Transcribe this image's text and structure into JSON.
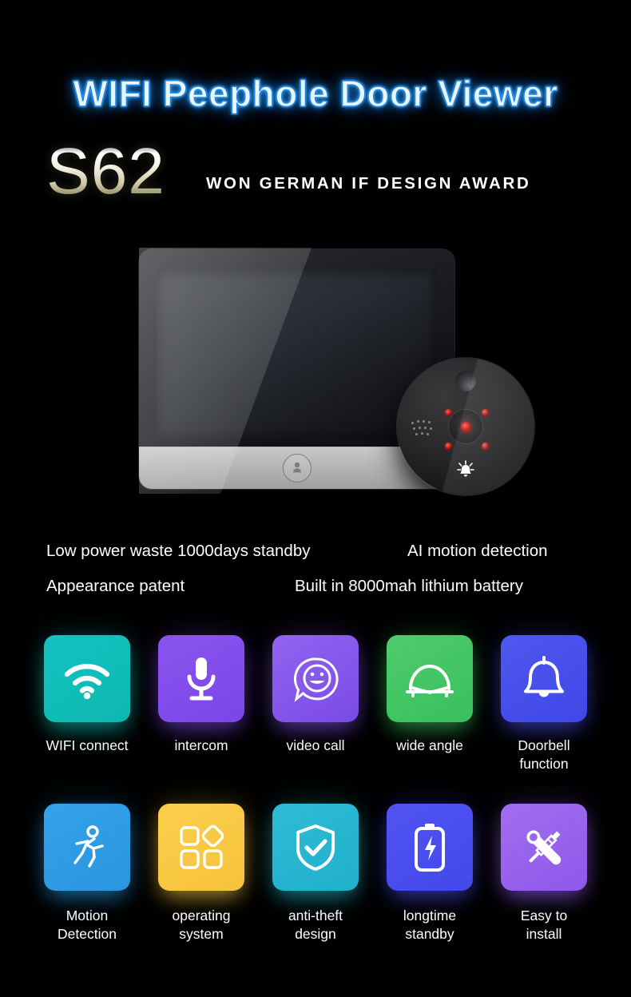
{
  "hero": {
    "title": "WIFI Peephole Door Viewer",
    "model": "S62",
    "award": "WON GERMAN IF DESIGN AWARD",
    "title_color": "#eaf6ff",
    "title_glow_color": "#1f86e0"
  },
  "product": {
    "monitor_name": "indoor-monitor",
    "home_button_icon": "person-icon",
    "camera_name": "outdoor-camera-unit",
    "camera_parts": {
      "pir_sensor": "pir-dome",
      "lens": "camera-lens",
      "ir_leds": 4,
      "microphone": "mic-grille",
      "doorbell_mark": "bell-icon"
    }
  },
  "sentences": [
    "Low power waste 1000days standby",
    "AI motion detection",
    "Appearance patent",
    "Built in 8000mah lithium battery"
  ],
  "features_row1": [
    {
      "label": "WIFI connect",
      "icon": "wifi-icon",
      "color_from": "#13c2c2",
      "color_to": "#0eb8b0",
      "glow": "#10c9c0"
    },
    {
      "label": "intercom",
      "icon": "microphone-icon",
      "color_from": "#8a55ee",
      "color_to": "#7b45e8",
      "glow": "#7d49ea"
    },
    {
      "label": "video call",
      "icon": "chat-smiley-icon",
      "color_from": "#9164f0",
      "color_to": "#7b4ae6",
      "glow": "#8352ee"
    },
    {
      "label": "wide angle",
      "icon": "wide-angle-lens-icon",
      "color_from": "#4fcb6e",
      "color_to": "#39c05c",
      "glow": "#3ec45f"
    },
    {
      "label": "Doorbell function",
      "icon": "bell-icon",
      "color_from": "#4f57ee",
      "color_to": "#3f48e8",
      "glow": "#4a53ec"
    }
  ],
  "features_row2": [
    {
      "label": "Motion\nDetection",
      "icon": "running-person-icon",
      "color_from": "#33a3ea",
      "color_to": "#2a95e0",
      "glow": "#2f9ce5"
    },
    {
      "label": "operating\nsystem",
      "icon": "apps-grid-icon",
      "color_from": "#fbcf4b",
      "color_to": "#f6c23c",
      "glow": "#f8c942"
    },
    {
      "label": "anti-theft\ndesign",
      "icon": "shield-check-icon",
      "color_from": "#2ebcd4",
      "color_to": "#1fb0cc",
      "glow": "#26b6d0"
    },
    {
      "label": "longtime\nstandby",
      "icon": "battery-bolt-icon",
      "color_from": "#5154f2",
      "color_to": "#4348ea",
      "glow": "#4a4eee"
    },
    {
      "label": "Easy to\ninstall",
      "icon": "tools-icon",
      "color_from": "#a06ef0",
      "color_to": "#8f58ea",
      "glow": "#9862ee"
    }
  ]
}
